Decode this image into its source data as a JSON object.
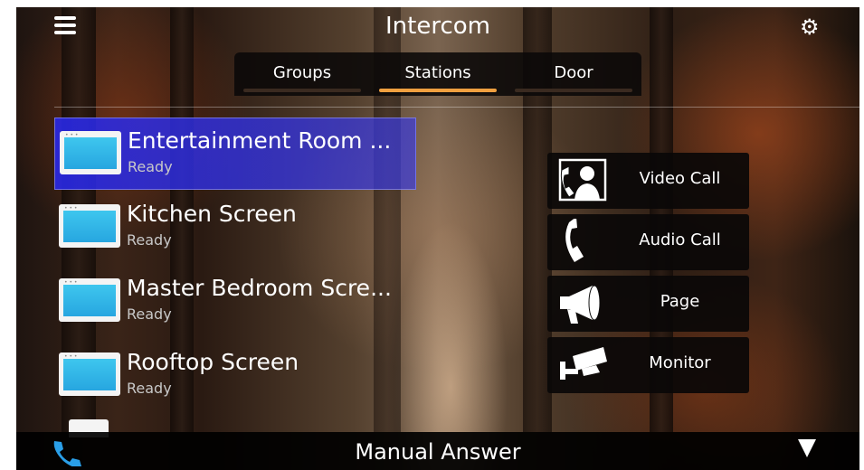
{
  "header": {
    "title": "Intercom"
  },
  "tabs": [
    {
      "label": "Groups"
    },
    {
      "label": "Stations"
    },
    {
      "label": "Door"
    }
  ],
  "active_tab": "Stations",
  "stations": [
    {
      "name": "Entertainment Room ...",
      "status": "Ready",
      "selected": true
    },
    {
      "name": "Kitchen Screen",
      "status": "Ready"
    },
    {
      "name": "Master Bedroom Scre...",
      "status": "Ready"
    },
    {
      "name": "Rooftop Screen",
      "status": "Ready"
    }
  ],
  "actions": [
    {
      "label": "Video Call",
      "icon": "video-call-icon"
    },
    {
      "label": "Audio Call",
      "icon": "phone-handset-icon"
    },
    {
      "label": "Page",
      "icon": "megaphone-icon"
    },
    {
      "label": "Monitor",
      "icon": "security-camera-icon"
    }
  ],
  "footer": {
    "label": "Manual Answer"
  },
  "colors": {
    "accent": "#f0a040",
    "selection": "#2f2fe0",
    "phone_icon": "#2a9fe8",
    "thumbnail_screen": "#3ec6ee"
  }
}
